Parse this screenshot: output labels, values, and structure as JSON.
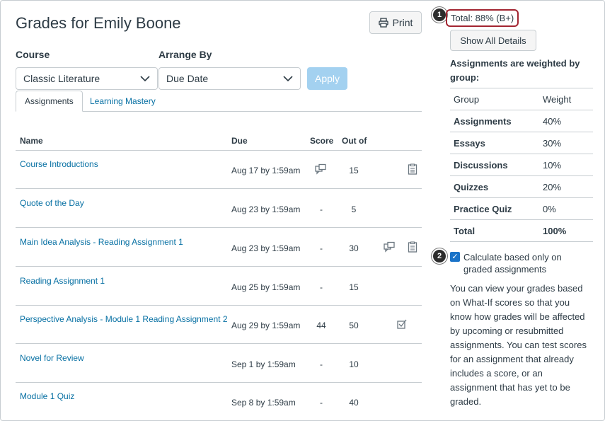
{
  "page": {
    "title": "Grades for Emily Boone",
    "print_label": "Print"
  },
  "filters": {
    "course_label": "Course",
    "course_value": "Classic Literature",
    "arrange_label": "Arrange By",
    "arrange_value": "Due Date",
    "apply_label": "Apply"
  },
  "tabs": [
    {
      "label": "Assignments",
      "active": true
    },
    {
      "label": "Learning Mastery",
      "active": false
    }
  ],
  "table": {
    "headers": {
      "name": "Name",
      "due": "Due",
      "score": "Score",
      "outof": "Out of"
    },
    "rows": [
      {
        "name": "Course Introductions",
        "due": "Aug 17 by 1:59am",
        "score": "",
        "outof": "15",
        "icons": [
          "comment-icon",
          "rubric-icon"
        ]
      },
      {
        "name": "Quote of the Day",
        "due": "Aug 23 by 1:59am",
        "score": "-",
        "outof": "5",
        "icons": []
      },
      {
        "name": "Main Idea Analysis - Reading Assignment 1",
        "due": "Aug 23 by 1:59am",
        "score": "-",
        "outof": "30",
        "icons": [
          "comment-icon",
          "rubric-icon"
        ]
      },
      {
        "name": "Reading Assignment 1",
        "due": "Aug 25 by 1:59am",
        "score": "-",
        "outof": "15",
        "icons": []
      },
      {
        "name": "Perspective Analysis - Module 1 Reading Assignment 2",
        "due": "Aug 29 by 1:59am",
        "score": "44",
        "outof": "50",
        "icons": [
          "muted-icon"
        ]
      },
      {
        "name": "Novel for Review",
        "due": "Sep 1 by 1:59am",
        "score": "-",
        "outof": "10",
        "icons": []
      },
      {
        "name": "Module 1 Quiz",
        "due": "Sep 8 by 1:59am",
        "score": "-",
        "outof": "40",
        "icons": []
      }
    ]
  },
  "sidebar": {
    "total": "Total: 88% (B+)",
    "badge1": "1",
    "badge2": "2",
    "show_details": "Show All Details",
    "weighted_title": "Assignments are weighted by group:",
    "weights_header": {
      "group": "Group",
      "weight": "Weight"
    },
    "weights": [
      {
        "group": "Assignments",
        "weight": "40%"
      },
      {
        "group": "Essays",
        "weight": "30%"
      },
      {
        "group": "Discussions",
        "weight": "10%"
      },
      {
        "group": "Quizzes",
        "weight": "20%"
      },
      {
        "group": "Practice Quiz",
        "weight": "0%"
      }
    ],
    "weights_total": {
      "group": "Total",
      "weight": "100%"
    },
    "checkbox_label": "Calculate based only on graded assignments",
    "checkbox_checked": true,
    "description": "You can view your grades based on What-If scores so that you know how grades will be affected by upcoming or resubmitted assignments. You can test scores for an assignment that already includes a score, or an assignment that has yet to be graded."
  },
  "colors": {
    "link": "#0770a3",
    "highlight_border": "#a22431",
    "apply_bg": "#a3d1f0"
  }
}
